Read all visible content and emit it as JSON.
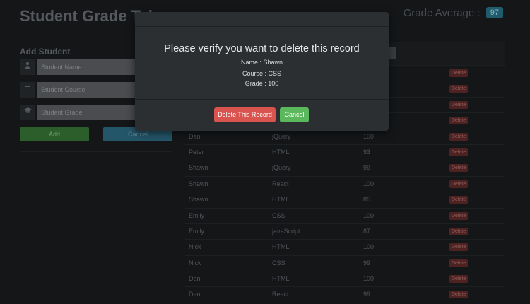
{
  "header": {
    "title": "Student Grade Tab",
    "average_label": "Grade Average :",
    "average_value": "97"
  },
  "form": {
    "title": "Add Student",
    "name_placeholder": "Student Name",
    "course_placeholder": "Student Course",
    "grade_placeholder": "Student Grade",
    "add_label": "Add",
    "cancel_label": "Cancel"
  },
  "icons": {
    "name": "user-icon",
    "course": "calendar-icon",
    "grade": "graduation-cap-icon"
  },
  "table": {
    "delete_label": "Delete",
    "rows": [
      {
        "name": "",
        "course": "",
        "grade": ""
      },
      {
        "name": "",
        "course": "",
        "grade": ""
      },
      {
        "name": "",
        "course": "",
        "grade": ""
      },
      {
        "name": "",
        "course": "",
        "grade": ""
      },
      {
        "name": "Dan",
        "course": "jQuery",
        "grade": "100"
      },
      {
        "name": "Peter",
        "course": "HTML",
        "grade": "93"
      },
      {
        "name": "Shawn",
        "course": "jQuery",
        "grade": "99"
      },
      {
        "name": "Shawn",
        "course": "React",
        "grade": "100"
      },
      {
        "name": "Shawn",
        "course": "HTML",
        "grade": "85"
      },
      {
        "name": "Emily",
        "course": "CSS",
        "grade": "100"
      },
      {
        "name": "Emily",
        "course": "javaScript",
        "grade": "87"
      },
      {
        "name": "Nick",
        "course": "HTML",
        "grade": "100"
      },
      {
        "name": "Nick",
        "course": "CSS",
        "grade": "99"
      },
      {
        "name": "Dan",
        "course": "HTML",
        "grade": "100"
      },
      {
        "name": "Dan",
        "course": "React",
        "grade": "99"
      }
    ]
  },
  "modal": {
    "question": "Please verify you want to delete this record",
    "name_line": "Name : Shawn",
    "course_line": "Course : CSS",
    "grade_line": "Grade : 100",
    "confirm_label": "Delete This Record",
    "cancel_label": "Cancel"
  },
  "colors": {
    "danger": "#d9534f",
    "success": "#5cb85c",
    "info": "#5bc0de"
  }
}
